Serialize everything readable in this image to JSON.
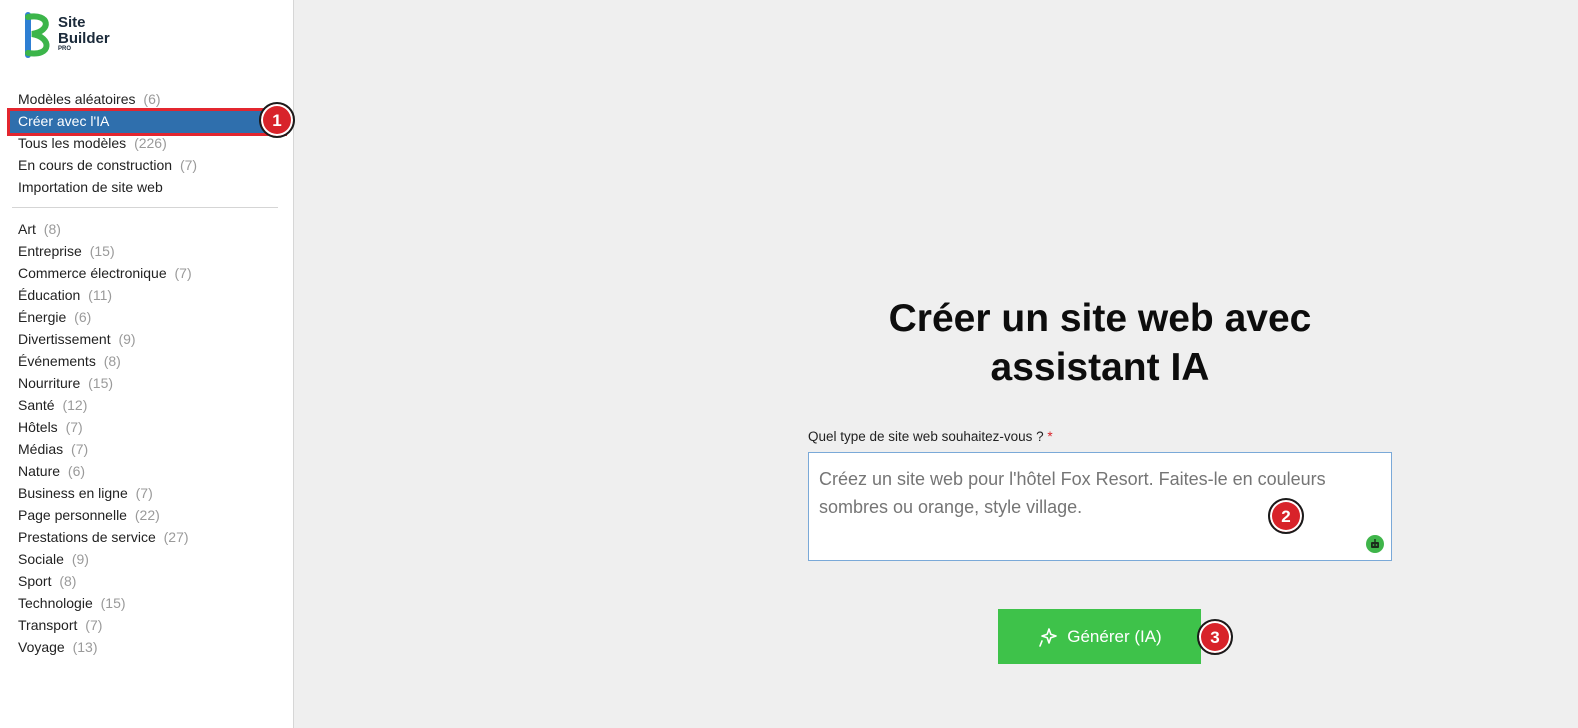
{
  "logo": {
    "line1": "Site",
    "line2": "Builder",
    "line3": "PRO"
  },
  "menu_top": [
    {
      "label": "Modèles aléatoires",
      "count": "(6)"
    },
    {
      "label": "Créer avec l'IA",
      "count": ""
    },
    {
      "label": "Tous les modèles",
      "count": "(226)"
    },
    {
      "label": "En cours de construction",
      "count": "(7)"
    },
    {
      "label": "Importation de site web",
      "count": ""
    }
  ],
  "categories": [
    {
      "label": "Art",
      "count": "(8)"
    },
    {
      "label": "Entreprise",
      "count": "(15)"
    },
    {
      "label": "Commerce électronique",
      "count": "(7)"
    },
    {
      "label": "Éducation",
      "count": "(11)"
    },
    {
      "label": "Énergie",
      "count": "(6)"
    },
    {
      "label": "Divertissement",
      "count": "(9)"
    },
    {
      "label": "Événements",
      "count": "(8)"
    },
    {
      "label": "Nourriture",
      "count": "(15)"
    },
    {
      "label": "Santé",
      "count": "(12)"
    },
    {
      "label": "Hôtels",
      "count": "(7)"
    },
    {
      "label": "Médias",
      "count": "(7)"
    },
    {
      "label": "Nature",
      "count": "(6)"
    },
    {
      "label": "Business en ligne",
      "count": "(7)"
    },
    {
      "label": "Page personnelle",
      "count": "(22)"
    },
    {
      "label": "Prestations de service",
      "count": "(27)"
    },
    {
      "label": "Sociale",
      "count": "(9)"
    },
    {
      "label": "Sport",
      "count": "(8)"
    },
    {
      "label": "Technologie",
      "count": "(15)"
    },
    {
      "label": "Transport",
      "count": "(7)"
    },
    {
      "label": "Voyage",
      "count": "(13)"
    }
  ],
  "main": {
    "title_line1": "Créer un site web avec",
    "title_line2": "assistant IA",
    "field_label": "Quel type de site web souhaitez-vous ?",
    "required_mark": "*",
    "placeholder": "Créez un site web pour l'hôtel Fox Resort. Faites-le en couleurs sombres ou orange, style village.",
    "value": "",
    "generate_label": "Générer (IA)"
  },
  "badges": [
    "1",
    "2",
    "3"
  ],
  "colors": {
    "accent_blue": "#2f6fad",
    "highlight_red": "#e3262f",
    "button_green": "#3ec24a",
    "badge_red": "#d8232a"
  },
  "icons": {
    "logo": "site-builder-logo",
    "generate": "sparkle-icon",
    "assistant": "robot-icon"
  }
}
